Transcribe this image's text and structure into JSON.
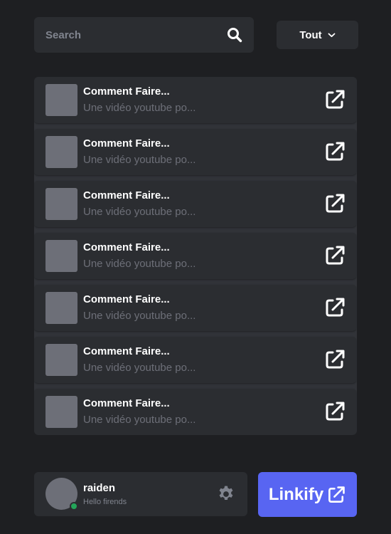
{
  "search": {
    "placeholder": "Search",
    "icon": "search-icon"
  },
  "filter": {
    "selected": "Tout",
    "icon": "chevron-down-icon"
  },
  "links": [
    {
      "title": "Comment Faire...",
      "description": "Une vidéo youtube po...",
      "icon": "external-link-icon"
    },
    {
      "title": "Comment Faire...",
      "description": "Une vidéo youtube po...",
      "icon": "external-link-icon"
    },
    {
      "title": "Comment Faire...",
      "description": "Une vidéo youtube po...",
      "icon": "external-link-icon"
    },
    {
      "title": "Comment Faire...",
      "description": "Une vidéo youtube po...",
      "icon": "external-link-icon"
    },
    {
      "title": "Comment Faire...",
      "description": "Une vidéo youtube po...",
      "icon": "external-link-icon"
    },
    {
      "title": "Comment Faire...",
      "description": "Une vidéo youtube po...",
      "icon": "external-link-icon"
    },
    {
      "title": "Comment Faire...",
      "description": "Une vidéo youtube po...",
      "icon": "external-link-icon"
    }
  ],
  "user": {
    "name": "raiden",
    "status_text": "Hello firends",
    "online": true,
    "settings_icon": "gear-icon"
  },
  "brand": {
    "label": "Linkify",
    "icon": "external-link-icon"
  },
  "colors": {
    "background": "#1e1f22",
    "panel": "#2b2d31",
    "accent": "#5865f2",
    "online": "#23a559"
  }
}
